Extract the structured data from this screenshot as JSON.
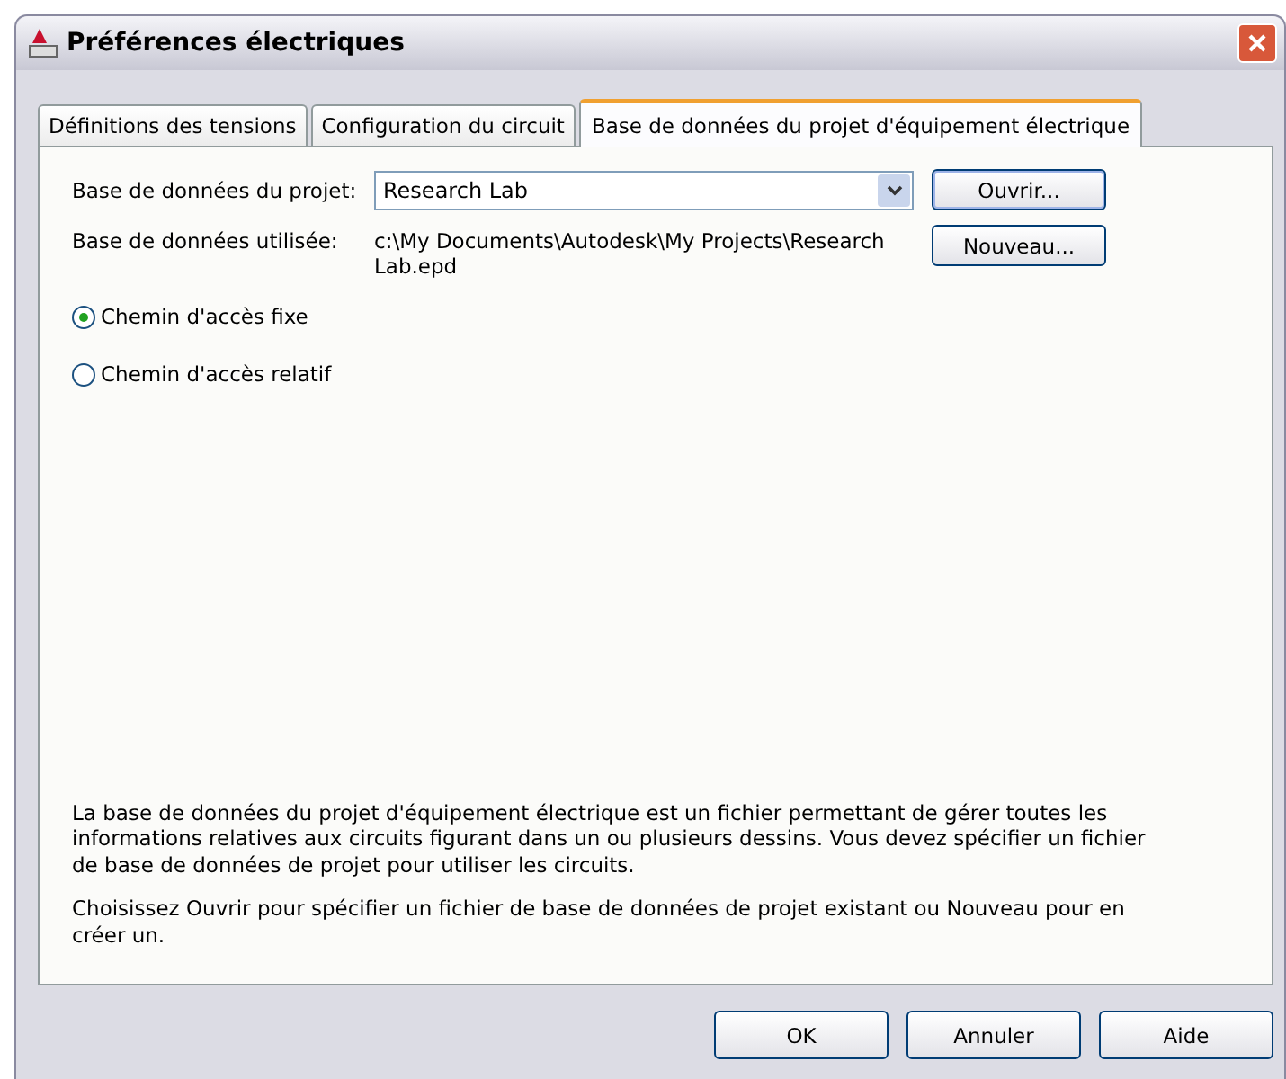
{
  "window": {
    "title": "Préférences électriques"
  },
  "tabs": [
    {
      "label": "Définitions des tensions",
      "selected": false
    },
    {
      "label": "Configuration du circuit",
      "selected": false
    },
    {
      "label": "Base de données du projet d'équipement électrique",
      "selected": true
    }
  ],
  "project_db": {
    "label": "Base de données du projet:",
    "value": "Research Lab",
    "button": "Ouvrir..."
  },
  "used_db": {
    "label": "Base de données utilisée:",
    "path": "c:\\My Documents\\Autodesk\\My Projects\\Research Lab.epd",
    "button": "Nouveau..."
  },
  "path_options": [
    {
      "label": "Chemin d'accès fixe",
      "selected": true
    },
    {
      "label": "Chemin d'accès relatif",
      "selected": false
    }
  ],
  "description": [
    "La base de données du projet d'équipement électrique est un fichier permettant de gérer toutes les informations relatives aux circuits figurant dans un ou plusieurs dessins. Vous devez spécifier un fichier de base de données de projet pour utiliser les circuits.",
    "Choisissez Ouvrir pour spécifier un fichier de base de données de projet existant ou Nouveau pour en créer un."
  ],
  "buttons": [
    "OK",
    "Annuler",
    "Aide"
  ]
}
